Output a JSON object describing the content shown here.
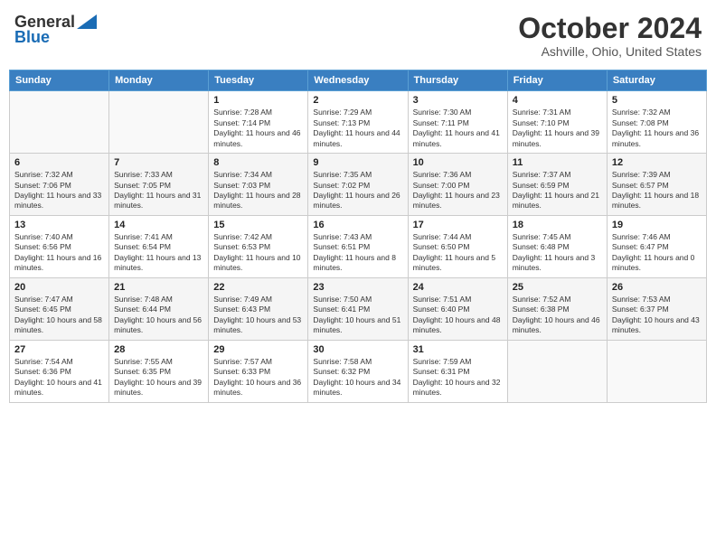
{
  "header": {
    "logo_general": "General",
    "logo_blue": "Blue",
    "month": "October 2024",
    "location": "Ashville, Ohio, United States"
  },
  "days_of_week": [
    "Sunday",
    "Monday",
    "Tuesday",
    "Wednesday",
    "Thursday",
    "Friday",
    "Saturday"
  ],
  "weeks": [
    [
      {
        "day": "",
        "info": ""
      },
      {
        "day": "",
        "info": ""
      },
      {
        "day": "1",
        "info": "Sunrise: 7:28 AM\nSunset: 7:14 PM\nDaylight: 11 hours and 46 minutes."
      },
      {
        "day": "2",
        "info": "Sunrise: 7:29 AM\nSunset: 7:13 PM\nDaylight: 11 hours and 44 minutes."
      },
      {
        "day": "3",
        "info": "Sunrise: 7:30 AM\nSunset: 7:11 PM\nDaylight: 11 hours and 41 minutes."
      },
      {
        "day": "4",
        "info": "Sunrise: 7:31 AM\nSunset: 7:10 PM\nDaylight: 11 hours and 39 minutes."
      },
      {
        "day": "5",
        "info": "Sunrise: 7:32 AM\nSunset: 7:08 PM\nDaylight: 11 hours and 36 minutes."
      }
    ],
    [
      {
        "day": "6",
        "info": "Sunrise: 7:32 AM\nSunset: 7:06 PM\nDaylight: 11 hours and 33 minutes."
      },
      {
        "day": "7",
        "info": "Sunrise: 7:33 AM\nSunset: 7:05 PM\nDaylight: 11 hours and 31 minutes."
      },
      {
        "day": "8",
        "info": "Sunrise: 7:34 AM\nSunset: 7:03 PM\nDaylight: 11 hours and 28 minutes."
      },
      {
        "day": "9",
        "info": "Sunrise: 7:35 AM\nSunset: 7:02 PM\nDaylight: 11 hours and 26 minutes."
      },
      {
        "day": "10",
        "info": "Sunrise: 7:36 AM\nSunset: 7:00 PM\nDaylight: 11 hours and 23 minutes."
      },
      {
        "day": "11",
        "info": "Sunrise: 7:37 AM\nSunset: 6:59 PM\nDaylight: 11 hours and 21 minutes."
      },
      {
        "day": "12",
        "info": "Sunrise: 7:39 AM\nSunset: 6:57 PM\nDaylight: 11 hours and 18 minutes."
      }
    ],
    [
      {
        "day": "13",
        "info": "Sunrise: 7:40 AM\nSunset: 6:56 PM\nDaylight: 11 hours and 16 minutes."
      },
      {
        "day": "14",
        "info": "Sunrise: 7:41 AM\nSunset: 6:54 PM\nDaylight: 11 hours and 13 minutes."
      },
      {
        "day": "15",
        "info": "Sunrise: 7:42 AM\nSunset: 6:53 PM\nDaylight: 11 hours and 10 minutes."
      },
      {
        "day": "16",
        "info": "Sunrise: 7:43 AM\nSunset: 6:51 PM\nDaylight: 11 hours and 8 minutes."
      },
      {
        "day": "17",
        "info": "Sunrise: 7:44 AM\nSunset: 6:50 PM\nDaylight: 11 hours and 5 minutes."
      },
      {
        "day": "18",
        "info": "Sunrise: 7:45 AM\nSunset: 6:48 PM\nDaylight: 11 hours and 3 minutes."
      },
      {
        "day": "19",
        "info": "Sunrise: 7:46 AM\nSunset: 6:47 PM\nDaylight: 11 hours and 0 minutes."
      }
    ],
    [
      {
        "day": "20",
        "info": "Sunrise: 7:47 AM\nSunset: 6:45 PM\nDaylight: 10 hours and 58 minutes."
      },
      {
        "day": "21",
        "info": "Sunrise: 7:48 AM\nSunset: 6:44 PM\nDaylight: 10 hours and 56 minutes."
      },
      {
        "day": "22",
        "info": "Sunrise: 7:49 AM\nSunset: 6:43 PM\nDaylight: 10 hours and 53 minutes."
      },
      {
        "day": "23",
        "info": "Sunrise: 7:50 AM\nSunset: 6:41 PM\nDaylight: 10 hours and 51 minutes."
      },
      {
        "day": "24",
        "info": "Sunrise: 7:51 AM\nSunset: 6:40 PM\nDaylight: 10 hours and 48 minutes."
      },
      {
        "day": "25",
        "info": "Sunrise: 7:52 AM\nSunset: 6:38 PM\nDaylight: 10 hours and 46 minutes."
      },
      {
        "day": "26",
        "info": "Sunrise: 7:53 AM\nSunset: 6:37 PM\nDaylight: 10 hours and 43 minutes."
      }
    ],
    [
      {
        "day": "27",
        "info": "Sunrise: 7:54 AM\nSunset: 6:36 PM\nDaylight: 10 hours and 41 minutes."
      },
      {
        "day": "28",
        "info": "Sunrise: 7:55 AM\nSunset: 6:35 PM\nDaylight: 10 hours and 39 minutes."
      },
      {
        "day": "29",
        "info": "Sunrise: 7:57 AM\nSunset: 6:33 PM\nDaylight: 10 hours and 36 minutes."
      },
      {
        "day": "30",
        "info": "Sunrise: 7:58 AM\nSunset: 6:32 PM\nDaylight: 10 hours and 34 minutes."
      },
      {
        "day": "31",
        "info": "Sunrise: 7:59 AM\nSunset: 6:31 PM\nDaylight: 10 hours and 32 minutes."
      },
      {
        "day": "",
        "info": ""
      },
      {
        "day": "",
        "info": ""
      }
    ]
  ]
}
